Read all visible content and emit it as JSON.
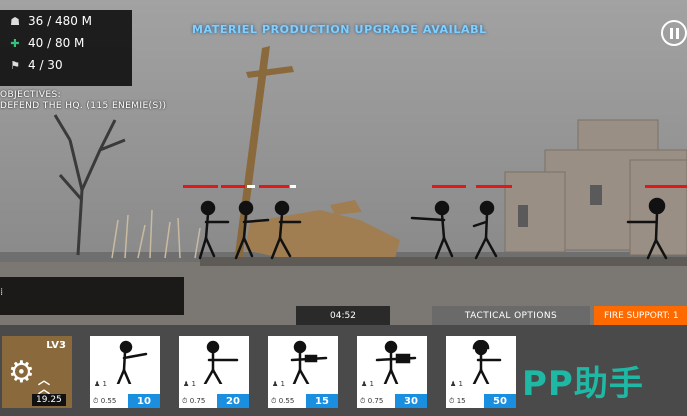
{
  "stats": {
    "manpower": "36 / 480 M",
    "materiel": "40 / 80 M",
    "units": "4 / 30"
  },
  "objectives": {
    "heading": "OBJECTIVES:",
    "text": "DEFEND THE HQ. (115 ENEMIE(S))"
  },
  "banner": "MATERIEL PRODUCTION UPGRADE AVAILABL",
  "timer": "04:52",
  "tactical_label": "TACTICAL OPTIONS",
  "support_label": "FIRE SUPPORT: 1",
  "upgrade": {
    "level": "LV3",
    "cost": "19.25"
  },
  "units": [
    {
      "count": "1",
      "rate": "0.55",
      "cost": "10",
      "icon": "rifleman-icon"
    },
    {
      "count": "1",
      "rate": "0.75",
      "cost": "20",
      "icon": "assault-soldier-icon"
    },
    {
      "count": "1",
      "rate": "0.55",
      "cost": "15",
      "icon": "machine-gunner-icon"
    },
    {
      "count": "1",
      "rate": "0.75",
      "cost": "30",
      "icon": "heavy-gunner-icon"
    },
    {
      "count": "1",
      "rate": "15",
      "cost": "50",
      "icon": "helmet-soldier-icon"
    }
  ],
  "watermark": "PP助手",
  "colors": {
    "banner": "#7fd0ff",
    "support": "#ff6a00",
    "cost": "#1a8fe0",
    "upgrade": "#8a6a3c",
    "health": "#e01818"
  }
}
